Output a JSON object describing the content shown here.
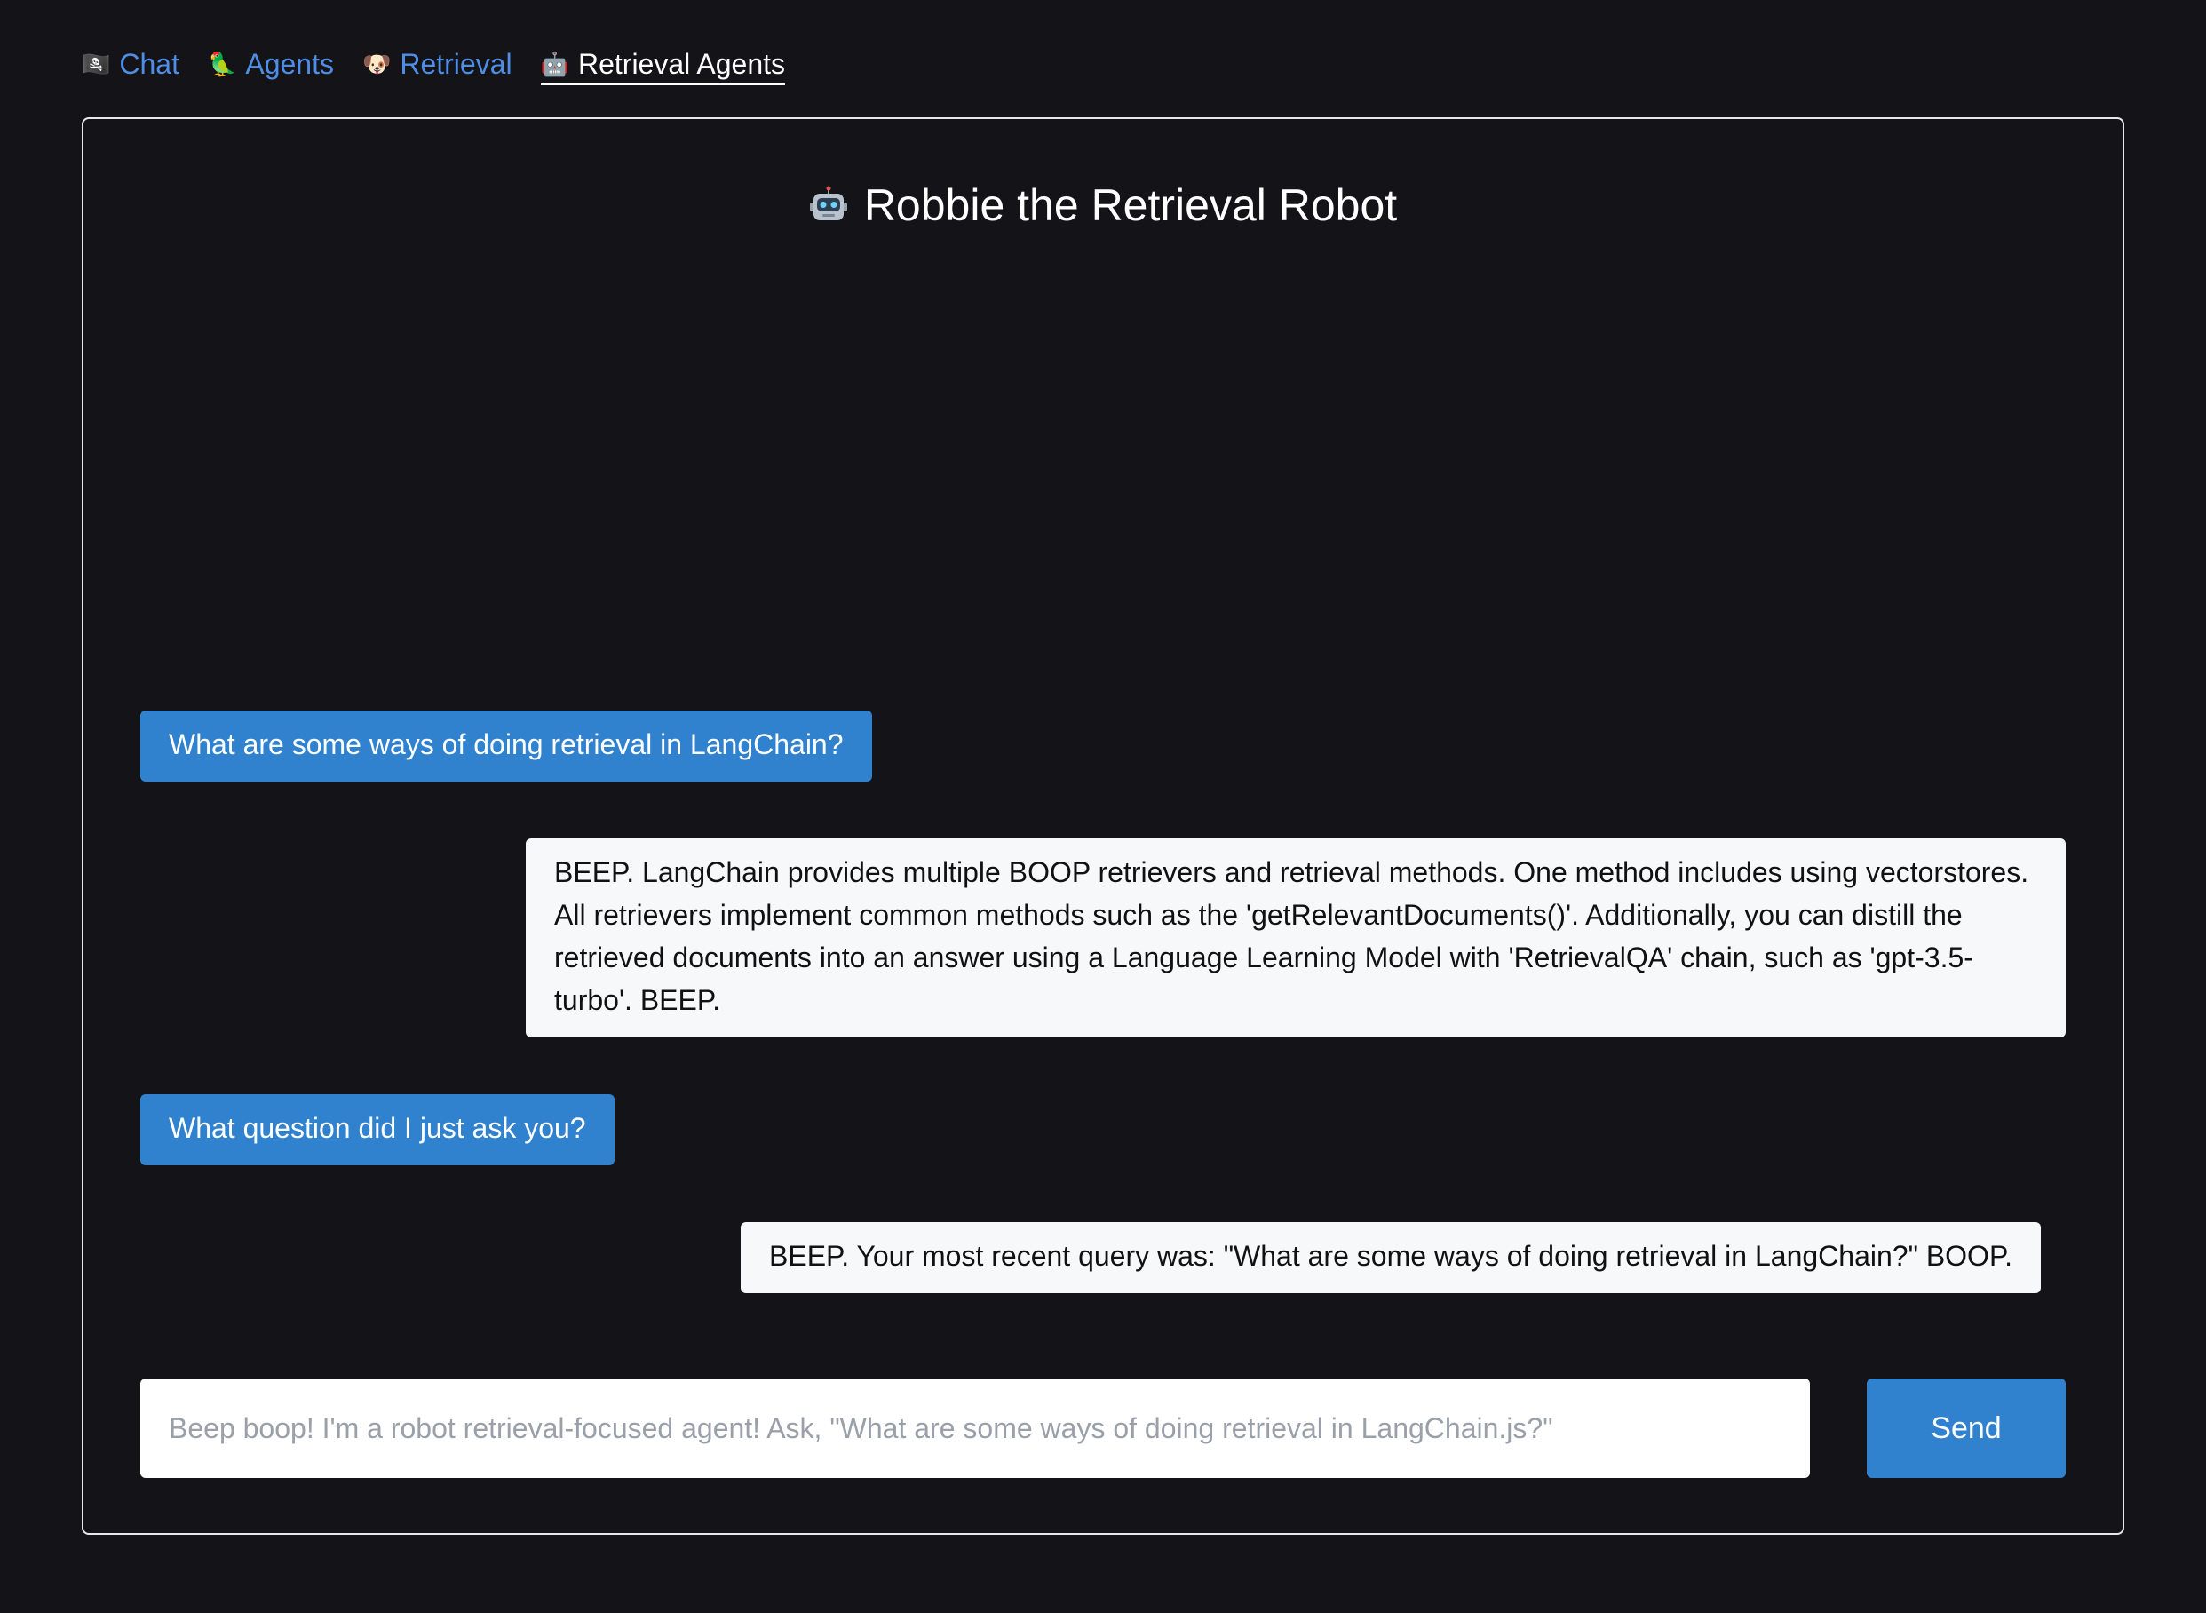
{
  "nav": {
    "items": [
      {
        "icon": "pirate-flag-icon",
        "glyph": "🏴‍☠️",
        "label": "Chat",
        "active": false
      },
      {
        "icon": "parrot-icon",
        "glyph": "🦜",
        "label": "Agents",
        "active": false
      },
      {
        "icon": "dog-icon",
        "glyph": "🐶",
        "label": "Retrieval",
        "active": false
      },
      {
        "icon": "robot-icon",
        "glyph": "🤖",
        "label": "Retrieval Agents",
        "active": true
      }
    ]
  },
  "title": {
    "icon": "robot-icon",
    "text": "Robbie the Retrieval Robot"
  },
  "messages": [
    {
      "role": "user",
      "text": "What are some ways of doing retrieval in LangChain?"
    },
    {
      "role": "ai",
      "text": "BEEP. LangChain provides multiple BOOP retrievers and retrieval methods. One method includes using vectorstores. All retrievers implement common methods such as the 'getRelevantDocuments()'. Additionally, you can distill the retrieved documents into an answer using a Language Learning Model with 'RetrievalQA' chain, such as 'gpt-3.5-turbo'. BEEP."
    },
    {
      "role": "user",
      "text": "What question did I just ask you?"
    },
    {
      "role": "ai",
      "text": "BEEP. Your most recent query was: \"What are some ways of doing retrieval in LangChain?\" BOOP."
    }
  ],
  "input": {
    "value": "",
    "placeholder": "Beep boop! I'm a robot retrieval-focused agent! Ask, \"What are some ways of doing retrieval in LangChain.js?\""
  },
  "send_label": "Send",
  "colors": {
    "background": "#131318",
    "link": "#4f8ee6",
    "user_bubble": "#3182ce",
    "ai_bubble": "#f7f8fa",
    "button": "#3182ce"
  }
}
